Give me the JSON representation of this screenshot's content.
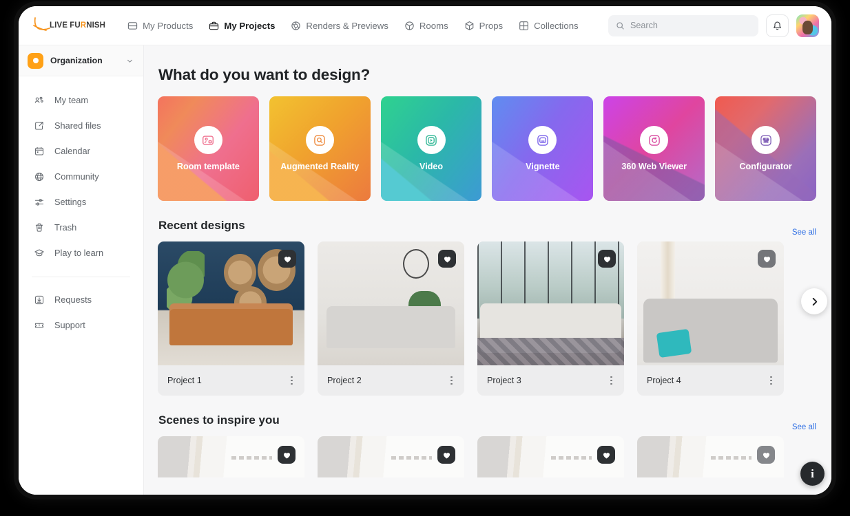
{
  "brand": {
    "logo_text_1": "LIVE FU",
    "logo_text_r": "R",
    "logo_text_2": "NISH",
    "accent_color": "#f7941e",
    "link_color": "#2f6fe4"
  },
  "topnav": {
    "items": [
      {
        "label": "My Products",
        "icon": "box-icon",
        "active": false
      },
      {
        "label": "My Projects",
        "icon": "briefcase-icon",
        "active": true
      },
      {
        "label": "Renders & Previews",
        "icon": "aperture-icon",
        "active": false
      },
      {
        "label": "Rooms",
        "icon": "cube-icon",
        "active": false
      },
      {
        "label": "Props",
        "icon": "package-icon",
        "active": false
      },
      {
        "label": "Collections",
        "icon": "grid-icon",
        "active": false
      }
    ]
  },
  "search": {
    "placeholder": "Search",
    "value": ""
  },
  "actions": {
    "notifications": "bell-icon",
    "avatar": "user-avatar"
  },
  "sidebar": {
    "org": {
      "name": "Organization",
      "chevron": "chevron-down-icon"
    },
    "items": [
      {
        "label": "My team",
        "icon": "people-icon"
      },
      {
        "label": "Shared files",
        "icon": "share-icon"
      },
      {
        "label": "Calendar",
        "icon": "calendar-icon"
      },
      {
        "label": "Community",
        "icon": "globe-icon"
      },
      {
        "label": "Settings",
        "icon": "sliders-icon"
      },
      {
        "label": "Trash",
        "icon": "trash-icon"
      },
      {
        "label": "Play to learn",
        "icon": "graduation-cap-icon"
      }
    ],
    "footer_items": [
      {
        "label": "Requests",
        "icon": "download-box-icon"
      },
      {
        "label": "Support",
        "icon": "ticket-icon"
      }
    ]
  },
  "main": {
    "page_title": "What do you want to design?",
    "design_types": [
      {
        "label": "Room template",
        "icon": "room-template-icon",
        "theme": "g-room"
      },
      {
        "label": "Augmented Reality",
        "icon": "ar-scan-icon",
        "theme": "g-ar"
      },
      {
        "label": "Video",
        "icon": "video-play-icon",
        "theme": "g-video"
      },
      {
        "label": "Vignette",
        "icon": "vignette-icon",
        "theme": "g-vign"
      },
      {
        "label": "360 Web Viewer",
        "icon": "rotate-360-icon",
        "theme": "g-360"
      },
      {
        "label": "Configurator",
        "icon": "configurator-icon",
        "theme": "g-conf"
      }
    ],
    "recent": {
      "title": "Recent designs",
      "see_all": "See all",
      "next_arrow": "chevron-right-icon",
      "projects": [
        {
          "name": "Project 1",
          "art": "t1",
          "favorite_icon": "heart-icon",
          "favorite_dim": false,
          "menu_icon": "kebab-menu-icon"
        },
        {
          "name": "Project 2",
          "art": "t2",
          "favorite_icon": "heart-icon",
          "favorite_dim": false,
          "menu_icon": "kebab-menu-icon"
        },
        {
          "name": "Project 3",
          "art": "t3",
          "favorite_icon": "heart-icon",
          "favorite_dim": false,
          "menu_icon": "kebab-menu-icon"
        },
        {
          "name": "Project 4",
          "art": "t4",
          "favorite_icon": "heart-icon",
          "favorite_dim": true,
          "menu_icon": "kebab-menu-icon"
        }
      ]
    },
    "scenes": {
      "title": "Scenes to inspire you",
      "see_all": "See all",
      "cards": [
        {
          "favorite_dim": false
        },
        {
          "favorite_dim": false
        },
        {
          "favorite_dim": false
        },
        {
          "favorite_dim": true
        }
      ]
    },
    "info_fab": "i"
  }
}
